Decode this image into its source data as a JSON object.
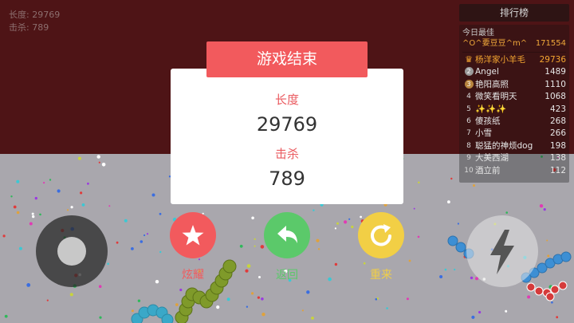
{
  "hud": {
    "length_label": "长度:",
    "length_value": "29769",
    "kills_label": "击杀:",
    "kills_value": "789"
  },
  "leaderboard": {
    "title": "排行榜",
    "today_label": "今日最佳",
    "today_best": {
      "name": "^O^要豆豆^m^",
      "score": "171554"
    },
    "rows": [
      {
        "rank": "",
        "name": "杨洋家小羊毛",
        "score": "29736",
        "style": "crown"
      },
      {
        "rank": "2",
        "name": "Angel",
        "score": "1489",
        "style": "badge"
      },
      {
        "rank": "3",
        "name": "艳阳高照",
        "score": "1110",
        "style": "badge"
      },
      {
        "rank": "4",
        "name": "微笑看明天",
        "score": "1068",
        "style": "plain"
      },
      {
        "rank": "5",
        "name": "✨✨✨",
        "score": "423",
        "style": "plain"
      },
      {
        "rank": "6",
        "name": "傻孩纸",
        "score": "268",
        "style": "plain"
      },
      {
        "rank": "7",
        "name": "小雪",
        "score": "266",
        "style": "plain"
      },
      {
        "rank": "8",
        "name": "聪猛的神烦dog",
        "score": "198",
        "style": "plain"
      },
      {
        "rank": "9",
        "name": "大美西湖",
        "score": "138",
        "style": "plain"
      },
      {
        "rank": "10",
        "name": "酒立前",
        "score": "112",
        "style": "plain"
      }
    ]
  },
  "game_over": {
    "title": "游戏结束",
    "length_label": "长度",
    "length_value": "29769",
    "kills_label": "击杀",
    "kills_value": "789"
  },
  "actions": {
    "share": {
      "label": "炫耀",
      "color": "#f25a5d",
      "icon": "star-icon"
    },
    "back": {
      "label": "返回",
      "color": "#5bc96a",
      "icon": "back-arrow-icon"
    },
    "retry": {
      "label": "重来",
      "color": "#f2cf45",
      "icon": "refresh-icon"
    }
  },
  "controls": {
    "joystick_icon": "joystick-icon",
    "boost_icon": "lightning-icon"
  },
  "colors": {
    "arena_top": "#4e1416",
    "arena_bottom": "#a9a7ad",
    "accent": "#f25a5d"
  }
}
